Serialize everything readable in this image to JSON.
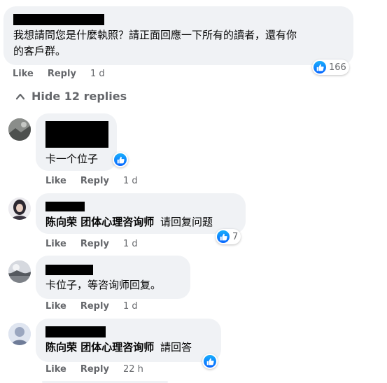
{
  "top_comment": {
    "text_line1": "我想請問您是什麼執照？請正面回應一下所有的讀者，還有你",
    "text_line2": "的客戶群。",
    "reaction_count": "166",
    "like_label": "Like",
    "reply_label": "Reply",
    "time": "1 d"
  },
  "hide_replies_label": "Hide 12 replies",
  "replies": [
    {
      "text": "卡一个位子",
      "like_label": "Like",
      "reply_label": "Reply",
      "time": "1 d"
    },
    {
      "mention": "陈向荣 团体心理咨询师",
      "text": "请回复问题",
      "reaction_count": "7",
      "like_label": "Like",
      "reply_label": "Reply",
      "time": "1 d"
    },
    {
      "text": "卡位子，等咨询师回复。",
      "like_label": "Like",
      "reply_label": "Reply",
      "time": "1 d"
    },
    {
      "mention": "陈向荣 团体心理咨询师",
      "text": "請回答",
      "like_label": "Like",
      "reply_label": "Reply",
      "time": "22 h"
    }
  ],
  "colors": {
    "bubble": "#f0f2f5",
    "like_blue": "#0866ff",
    "secondary_text": "#65676b"
  },
  "icons": [
    "thumbs-up-icon",
    "chevron-up-icon",
    "avatar"
  ]
}
